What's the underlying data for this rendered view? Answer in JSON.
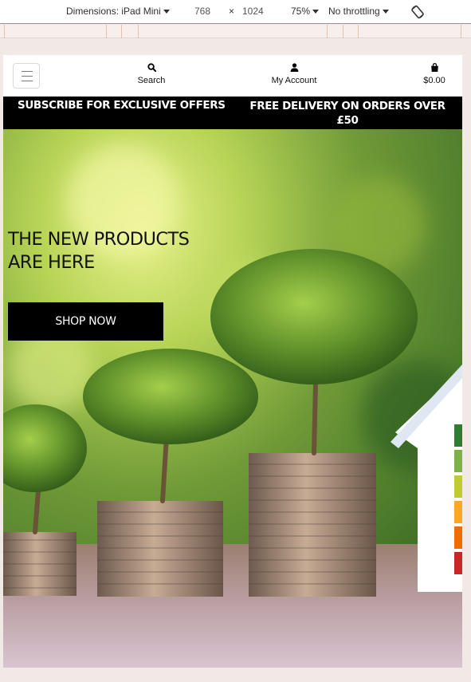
{
  "devtools": {
    "dimensions_label": "Dimensions: iPad Mini",
    "width": "768",
    "times": "×",
    "height": "1024",
    "zoom": "75%",
    "throttling": "No throttling"
  },
  "nav": {
    "search_label": "Search",
    "account_label": "My Account",
    "cart_total": "$0.00"
  },
  "promo": {
    "subscribe": "SUBSCRIBE FOR EXCLUSIVE OFFERS",
    "delivery": "FREE DELIVERY ON ORDERS OVER £50"
  },
  "hero": {
    "headline_line1": "THE NEW PRODUCTS",
    "headline_line2": "ARE HERE",
    "cta": "SHOP NOW"
  },
  "colors": {
    "promo_bg": "#000000",
    "cta_bg": "#000000",
    "page_bg": "#f0e9e6"
  },
  "icons": [
    "menu-icon",
    "search-icon",
    "user-icon",
    "shopping-bag-icon",
    "rotate-icon"
  ]
}
